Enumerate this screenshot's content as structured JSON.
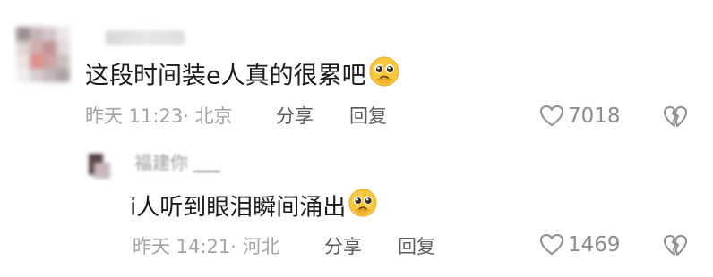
{
  "comment": {
    "text": "这段时间装e人真的很累吧",
    "emoji": "pleading-face-emoji",
    "time": "昨天 11:23",
    "location": "北京",
    "share_label": "分享",
    "reply_label": "回复",
    "likes": "7018"
  },
  "reply": {
    "username": "福建你",
    "text": "i人听到眼泪瞬间涌出",
    "emoji": "pleading-face-emoji",
    "time": "昨天 14:21",
    "location": "河北",
    "share_label": "分享",
    "reply_label": "回复",
    "likes": "1469"
  },
  "colors": {
    "text": "#1a1a1a",
    "meta": "#a3a3a3",
    "action": "#5a5a5a",
    "like": "#8c8c8c"
  }
}
